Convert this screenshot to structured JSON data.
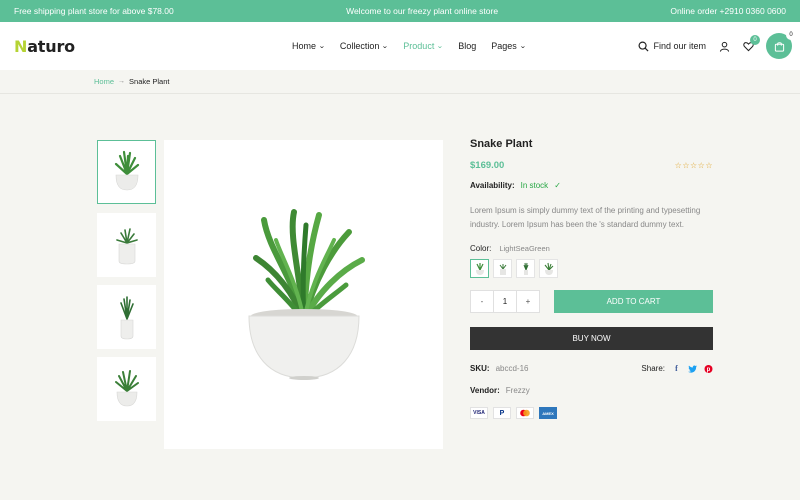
{
  "topbar": {
    "shipping": "Free shipping plant store for above $78.00",
    "welcome": "Welcome to our freezy plant online store",
    "phone": "Online order +2910 0360 0600"
  },
  "header": {
    "logo_first": "N",
    "logo_rest": "aturo",
    "nav": [
      {
        "label": "Home",
        "dropdown": true
      },
      {
        "label": "Collection",
        "dropdown": true
      },
      {
        "label": "Product",
        "dropdown": true,
        "active": true
      },
      {
        "label": "Blog",
        "dropdown": false
      },
      {
        "label": "Pages",
        "dropdown": true
      }
    ],
    "search_label": "Find our item",
    "wishlist_count": "0",
    "cart_count": "0"
  },
  "breadcrumb": {
    "home": "Home",
    "current": "Snake Plant"
  },
  "product": {
    "title": "Snake Plant",
    "price": "$169.00",
    "rating": 0,
    "availability_label": "Availability:",
    "availability_value": "In stock",
    "description": "Lorem Ipsum is simply dummy text of the printing and typesetting industry. Lorem Ipsum has been the 's standard dummy text.",
    "color_label": "Color:",
    "color_value": "LightSeaGreen",
    "quantity": "1",
    "add_to_cart": "ADD TO CART",
    "buy_now": "BUY NOW",
    "sku_label": "SKU:",
    "sku_value": "abccd-16",
    "share_label": "Share:",
    "vendor_label": "Vendor:",
    "vendor_value": "Frezzy",
    "payments": [
      "VISA",
      "PayPal",
      "Mastercard",
      "AMEX"
    ]
  },
  "colors": {
    "accent": "#5cbf97",
    "dark": "#333333",
    "logo_accent": "#b5d334"
  }
}
